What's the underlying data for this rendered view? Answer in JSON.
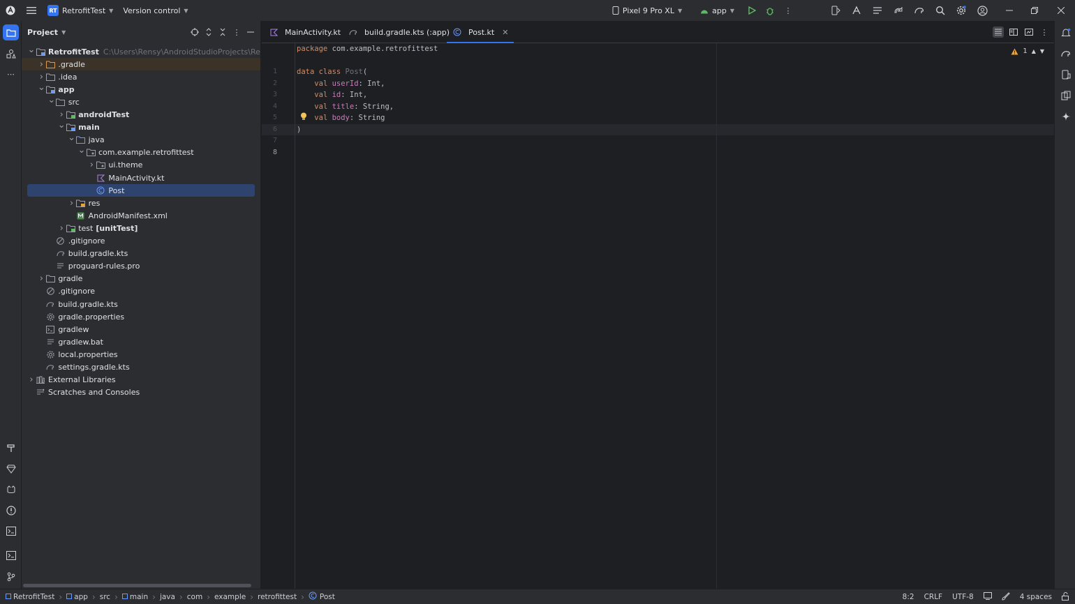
{
  "titlebar": {
    "project_badge": "RT",
    "project_name": "RetrofitTest",
    "vcs_label": "Version control",
    "device": "Pixel 9 Pro XL",
    "run_config": "app"
  },
  "project_panel": {
    "title": "Project",
    "root_path": "C:\\Users\\Rensy\\AndroidStudioProjects\\RetrofitTest",
    "tree": [
      {
        "label": "RetrofitTest",
        "depth": 0,
        "arrow": "down",
        "icon": "module-folder-icon",
        "bold": true
      },
      {
        "label": ".gradle",
        "depth": 1,
        "arrow": "right",
        "icon": "folder-orange-icon"
      },
      {
        "label": ".idea",
        "depth": 1,
        "arrow": "right",
        "icon": "folder-icon"
      },
      {
        "label": "app",
        "depth": 1,
        "arrow": "down",
        "icon": "module-folder-icon",
        "bold": true
      },
      {
        "label": "src",
        "depth": 2,
        "arrow": "down",
        "icon": "folder-icon"
      },
      {
        "label": "androidTest",
        "depth": 3,
        "arrow": "right",
        "icon": "test-folder-icon",
        "bold": true
      },
      {
        "label": "main",
        "depth": 3,
        "arrow": "down",
        "icon": "source-folder-icon",
        "bold": true
      },
      {
        "label": "java",
        "depth": 4,
        "arrow": "down",
        "icon": "java-folder-icon"
      },
      {
        "label": "com.example.retrofittest",
        "depth": 5,
        "arrow": "down",
        "icon": "package-icon"
      },
      {
        "label": "ui.theme",
        "depth": 6,
        "arrow": "right",
        "icon": "package-icon"
      },
      {
        "label": "MainActivity.kt",
        "depth": 6,
        "arrow": "",
        "icon": "kotlin-file-icon"
      },
      {
        "label": "Post",
        "depth": 6,
        "arrow": "",
        "icon": "kotlin-class-icon",
        "selected": true
      },
      {
        "label": "res",
        "depth": 4,
        "arrow": "right",
        "icon": "res-folder-icon"
      },
      {
        "label": "AndroidManifest.xml",
        "depth": 4,
        "arrow": "",
        "icon": "manifest-icon"
      },
      {
        "label": "test",
        "label_suffix": "[unitTest]",
        "depth": 3,
        "arrow": "right",
        "icon": "test-folder-icon"
      },
      {
        "label": ".gitignore",
        "depth": 2,
        "arrow": "",
        "icon": "gitignore-icon"
      },
      {
        "label": "build.gradle.kts",
        "depth": 2,
        "arrow": "",
        "icon": "gradle-file-icon"
      },
      {
        "label": "proguard-rules.pro",
        "depth": 2,
        "arrow": "",
        "icon": "text-file-icon"
      },
      {
        "label": "gradle",
        "depth": 1,
        "arrow": "right",
        "icon": "folder-icon"
      },
      {
        "label": ".gitignore",
        "depth": 1,
        "arrow": "",
        "icon": "gitignore-icon"
      },
      {
        "label": "build.gradle.kts",
        "depth": 1,
        "arrow": "",
        "icon": "gradle-file-icon"
      },
      {
        "label": "gradle.properties",
        "depth": 1,
        "arrow": "",
        "icon": "settings-file-icon"
      },
      {
        "label": "gradlew",
        "depth": 1,
        "arrow": "",
        "icon": "shell-file-icon"
      },
      {
        "label": "gradlew.bat",
        "depth": 1,
        "arrow": "",
        "icon": "text-file-icon"
      },
      {
        "label": "local.properties",
        "depth": 1,
        "arrow": "",
        "icon": "settings-file-icon"
      },
      {
        "label": "settings.gradle.kts",
        "depth": 1,
        "arrow": "",
        "icon": "gradle-file-icon"
      },
      {
        "label": "External Libraries",
        "depth": 0,
        "arrow": "right",
        "icon": "libraries-icon"
      },
      {
        "label": "Scratches and Consoles",
        "depth": 0,
        "arrow": "",
        "icon": "scratches-icon"
      }
    ]
  },
  "editor": {
    "tabs": [
      {
        "label": "MainActivity.kt",
        "icon": "kotlin-file-icon",
        "active": false
      },
      {
        "label": "build.gradle.kts (:app)",
        "icon": "gradle-file-icon",
        "active": false
      },
      {
        "label": "Post.kt",
        "icon": "kotlin-class-icon",
        "active": true
      }
    ],
    "warning_count": "1",
    "current_line": 8,
    "lines": [
      [
        {
          "t": "package",
          "c": "kw"
        },
        {
          "t": " com.example.retrofittest",
          "c": ""
        }
      ],
      [],
      [
        {
          "t": "data class",
          "c": "kw"
        },
        {
          "t": " ",
          "c": ""
        },
        {
          "t": "Post",
          "c": "cls"
        },
        {
          "t": "(",
          "c": ""
        }
      ],
      [
        {
          "t": "    ",
          "c": ""
        },
        {
          "t": "val",
          "c": "kw"
        },
        {
          "t": " ",
          "c": ""
        },
        {
          "t": "userId",
          "c": "prop"
        },
        {
          "t": ": Int,",
          "c": ""
        }
      ],
      [
        {
          "t": "    ",
          "c": ""
        },
        {
          "t": "val",
          "c": "kw"
        },
        {
          "t": " ",
          "c": ""
        },
        {
          "t": "id",
          "c": "prop"
        },
        {
          "t": ": Int,",
          "c": ""
        }
      ],
      [
        {
          "t": "    ",
          "c": ""
        },
        {
          "t": "val",
          "c": "kw"
        },
        {
          "t": " ",
          "c": ""
        },
        {
          "t": "title",
          "c": "prop"
        },
        {
          "t": ": String,",
          "c": ""
        }
      ],
      [
        {
          "t": "    ",
          "c": ""
        },
        {
          "t": "val",
          "c": "kw"
        },
        {
          "t": " ",
          "c": ""
        },
        {
          "t": "body",
          "c": "prop"
        },
        {
          "t": ": String",
          "c": ""
        }
      ],
      [
        {
          "t": ")",
          "c": ""
        }
      ]
    ]
  },
  "statusbar": {
    "breadcrumbs": [
      "RetrofitTest",
      "app",
      "src",
      "main",
      "java",
      "com",
      "example",
      "retrofittest",
      "Post"
    ],
    "position": "8:2",
    "line_ending": "CRLF",
    "encoding": "UTF-8",
    "indent": "4 spaces"
  },
  "colors": {
    "accent": "#3574f0",
    "selection": "#2e436e",
    "keyword": "#cf8e6d",
    "property": "#c77dbb"
  }
}
